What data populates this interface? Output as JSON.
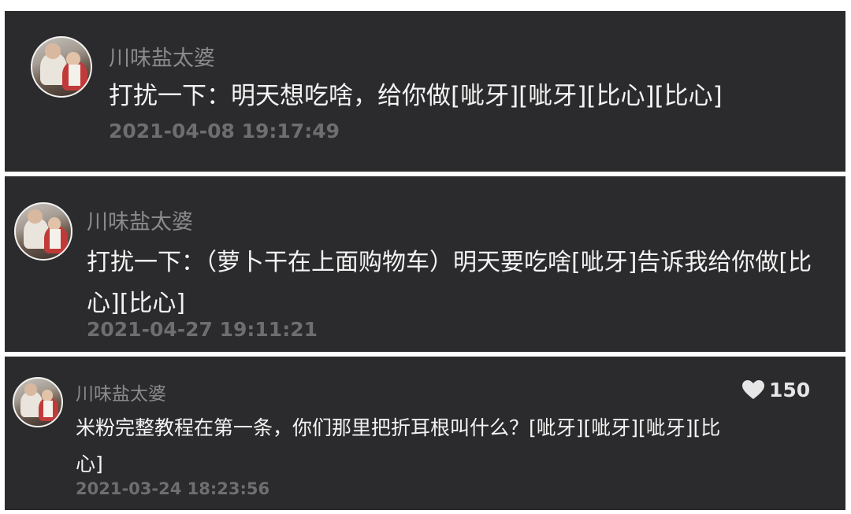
{
  "comments": [
    {
      "username": "川味盐太婆",
      "text": "打扰一下：明天想吃啥，给你做[呲牙][呲牙][比心][比心]",
      "timestamp": "2021-04-08 19:17:49"
    },
    {
      "username": "川味盐太婆",
      "text": "打扰一下：（萝卜干在上面购物车）明天要吃啥[呲牙]告诉我给你做[比心][比心]",
      "timestamp": "2021-04-27 19:11:21"
    },
    {
      "username": "川味盐太婆",
      "text": "米粉完整教程在第一条，你们那里把折耳根叫什么？[呲牙][呲牙][呲牙][比心]",
      "timestamp": "2021-03-24 18:23:56",
      "like_count": "150"
    }
  ],
  "icons": {
    "avatar": "user-avatar",
    "like": "heart-icon"
  },
  "colors": {
    "panel_bg": "#2b2b2d",
    "text": "#f3f3f3",
    "username": "#8a8a8c",
    "timestamp": "#6e6e70"
  }
}
